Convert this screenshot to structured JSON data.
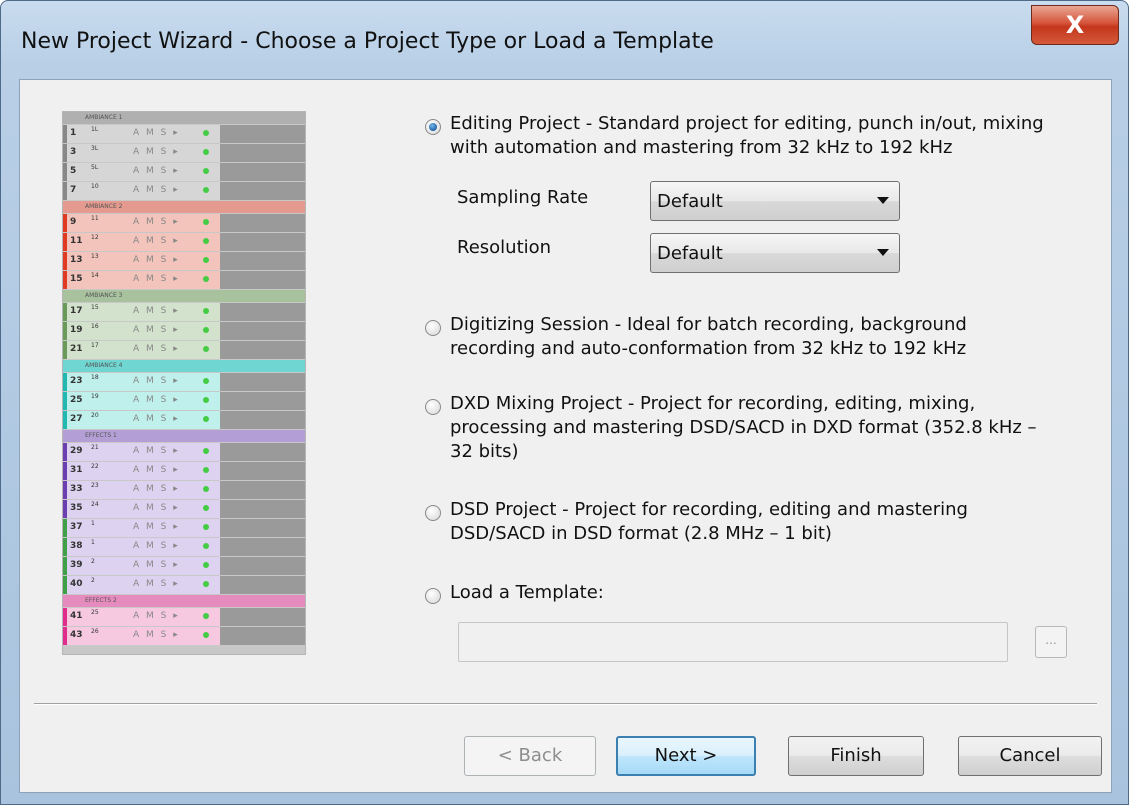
{
  "window": {
    "title": "New Project Wizard - Choose a Project Type or Load a Template",
    "close_label": "X"
  },
  "preview": {
    "tracks": [
      {
        "kind": "header",
        "label": "AMBIANCE 1",
        "color": "#b0b0b0"
      },
      {
        "kind": "track",
        "num": "1",
        "sub": "1L",
        "ams": "A M S ▸",
        "color": "#d6d6d6",
        "accent": "#888888"
      },
      {
        "kind": "track",
        "num": "3",
        "sub": "3L",
        "ams": "A M S ▸",
        "color": "#d6d6d6",
        "accent": "#888888"
      },
      {
        "kind": "track",
        "num": "5",
        "sub": "5L",
        "ams": "A M S ▸",
        "color": "#d6d6d6",
        "accent": "#888888"
      },
      {
        "kind": "track",
        "num": "7",
        "sub": "10",
        "ams": "A M S ▸",
        "color": "#d6d6d6",
        "accent": "#888888"
      },
      {
        "kind": "header",
        "label": "AMBIANCE 2",
        "color": "#e49a8e"
      },
      {
        "kind": "track",
        "num": "9",
        "sub": "11",
        "ams": "A M S ▸",
        "color": "#f2c4bb",
        "accent": "#e03a23"
      },
      {
        "kind": "track",
        "num": "11",
        "sub": "12",
        "ams": "A M S ▸",
        "color": "#f2c4bb",
        "accent": "#e03a23"
      },
      {
        "kind": "track",
        "num": "13",
        "sub": "13",
        "ams": "A M S ▸",
        "color": "#f2c4bb",
        "accent": "#e03a23"
      },
      {
        "kind": "track",
        "num": "15",
        "sub": "14",
        "ams": "A M S ▸",
        "color": "#f2c4bb",
        "accent": "#e03a23"
      },
      {
        "kind": "header",
        "label": "AMBIANCE 3",
        "color": "#a8c29e"
      },
      {
        "kind": "track",
        "num": "17",
        "sub": "15",
        "ams": "A M S ▸",
        "color": "#d3e2cc",
        "accent": "#6a9a5a"
      },
      {
        "kind": "track",
        "num": "19",
        "sub": "16",
        "ams": "A M S ▸",
        "color": "#d3e2cc",
        "accent": "#6a9a5a"
      },
      {
        "kind": "track",
        "num": "21",
        "sub": "17",
        "ams": "A M S ▸",
        "color": "#d3e2cc",
        "accent": "#6a9a5a"
      },
      {
        "kind": "header",
        "label": "AMBIANCE 4",
        "color": "#6fd6d1"
      },
      {
        "kind": "track",
        "num": "23",
        "sub": "18",
        "ams": "A M S ▸",
        "color": "#bff0ec",
        "accent": "#20b8b0"
      },
      {
        "kind": "track",
        "num": "25",
        "sub": "19",
        "ams": "A M S ▸",
        "color": "#bff0ec",
        "accent": "#20b8b0"
      },
      {
        "kind": "track",
        "num": "27",
        "sub": "20",
        "ams": "A M S ▸",
        "color": "#bff0ec",
        "accent": "#20b8b0"
      },
      {
        "kind": "header",
        "label": "EFFECTS 1",
        "color": "#b39fd6"
      },
      {
        "kind": "track",
        "num": "29",
        "sub": "21",
        "ams": "A M S ▸",
        "color": "#ddd2ef",
        "accent": "#6b3fb0"
      },
      {
        "kind": "track",
        "num": "31",
        "sub": "22",
        "ams": "A M S ▸",
        "color": "#ddd2ef",
        "accent": "#6b3fb0"
      },
      {
        "kind": "track",
        "num": "33",
        "sub": "23",
        "ams": "A M S ▸",
        "color": "#ddd2ef",
        "accent": "#6b3fb0"
      },
      {
        "kind": "track",
        "num": "35",
        "sub": "24",
        "ams": "A M S ▸",
        "color": "#ddd2ef",
        "accent": "#6b3fb0"
      },
      {
        "kind": "track",
        "num": "37",
        "sub": "1",
        "ams": "A M S ▸",
        "color": "#ddd2ef",
        "accent": "#3fa04a"
      },
      {
        "kind": "track",
        "num": "38",
        "sub": "1",
        "ams": "A M S ▸",
        "color": "#ddd2ef",
        "accent": "#3fa04a"
      },
      {
        "kind": "track",
        "num": "39",
        "sub": "2",
        "ams": "A M S ▸",
        "color": "#ddd2ef",
        "accent": "#3fa04a"
      },
      {
        "kind": "track",
        "num": "40",
        "sub": "2",
        "ams": "A M S ▸",
        "color": "#ddd2ef",
        "accent": "#3fa04a"
      },
      {
        "kind": "header",
        "label": "EFFECTS 2",
        "color": "#e68bbd"
      },
      {
        "kind": "track",
        "num": "41",
        "sub": "25",
        "ams": "A M S ▸",
        "color": "#f6c9e0",
        "accent": "#e02c8c"
      },
      {
        "kind": "track",
        "num": "43",
        "sub": "26",
        "ams": "A M S ▸",
        "color": "#f6c9e0",
        "accent": "#e02c8c"
      }
    ]
  },
  "options": {
    "editing": {
      "text": "Editing Project - Standard project for editing, punch in/out, mixing with automation and mastering from 32 kHz to 192 kHz",
      "selected": true
    },
    "sampling_rate": {
      "label": "Sampling Rate",
      "value": "Default"
    },
    "resolution": {
      "label": "Resolution",
      "value": "Default"
    },
    "digitizing": {
      "text": "Digitizing Session - Ideal for batch recording, background recording and auto-conformation from 32 kHz to 192 kHz",
      "selected": false
    },
    "dxd": {
      "text": "DXD Mixing Project - Project for recording, editing, mixing, processing and mastering DSD/SACD in DXD format (352.8 kHz – 32 bits)",
      "selected": false
    },
    "dsd": {
      "text": "DSD Project - Project for recording, editing and mastering DSD/SACD in DSD format (2.8 MHz – 1 bit)",
      "selected": false
    },
    "template": {
      "text": "Load a Template:",
      "selected": false,
      "path_value": "",
      "browse_label": "..."
    }
  },
  "buttons": {
    "back": "< Back",
    "next": "Next >",
    "finish": "Finish",
    "cancel": "Cancel"
  }
}
